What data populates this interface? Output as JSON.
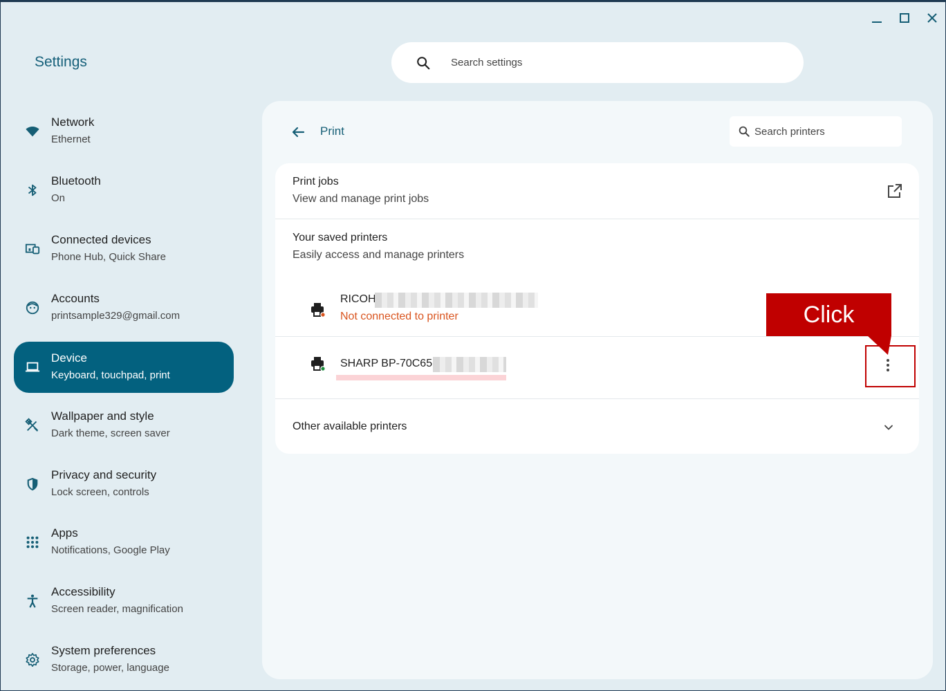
{
  "window": {
    "title": "Settings",
    "controls": [
      "minimize-icon",
      "maximize-icon",
      "close-icon"
    ]
  },
  "search": {
    "placeholder": "Search settings"
  },
  "sidebar": {
    "items": [
      {
        "title": "Network",
        "subtitle": "Ethernet",
        "icon": "wifi-icon"
      },
      {
        "title": "Bluetooth",
        "subtitle": "On",
        "icon": "bluetooth-icon"
      },
      {
        "title": "Connected devices",
        "subtitle": "Phone Hub, Quick Share",
        "icon": "devices-icon"
      },
      {
        "title": "Accounts",
        "subtitle": "printsample329@gmail.com",
        "icon": "account-icon"
      },
      {
        "title": "Device",
        "subtitle": "Keyboard, touchpad, print",
        "icon": "laptop-icon",
        "active": true
      },
      {
        "title": "Wallpaper and style",
        "subtitle": "Dark theme, screen saver",
        "icon": "palette-icon"
      },
      {
        "title": "Privacy and security",
        "subtitle": "Lock screen, controls",
        "icon": "shield-icon"
      },
      {
        "title": "Apps",
        "subtitle": "Notifications, Google Play",
        "icon": "apps-grid-icon"
      },
      {
        "title": "Accessibility",
        "subtitle": "Screen reader, magnification",
        "icon": "accessibility-icon"
      },
      {
        "title": "System preferences",
        "subtitle": "Storage, power, language",
        "icon": "gear-icon"
      }
    ]
  },
  "page": {
    "title": "Print",
    "search_printers_placeholder": "Search printers",
    "print_jobs": {
      "title": "Print jobs",
      "subtitle": "View and manage print jobs"
    },
    "saved_printers": {
      "title": "Your saved printers",
      "subtitle": "Easily access and manage printers",
      "printers": [
        {
          "name": "RICOH",
          "status": "Not connected to printer",
          "status_color": "#d9541e"
        },
        {
          "name": "SHARP BP-70C65",
          "status": "",
          "status_color": "#1e8e3e"
        }
      ]
    },
    "other_printers": {
      "title": "Other available printers"
    }
  },
  "annotation": {
    "callout_text": "Click",
    "color": "#c00000"
  },
  "colors": {
    "accent": "#155e75",
    "active_bg": "#03617f",
    "background": "#e2edf2"
  }
}
